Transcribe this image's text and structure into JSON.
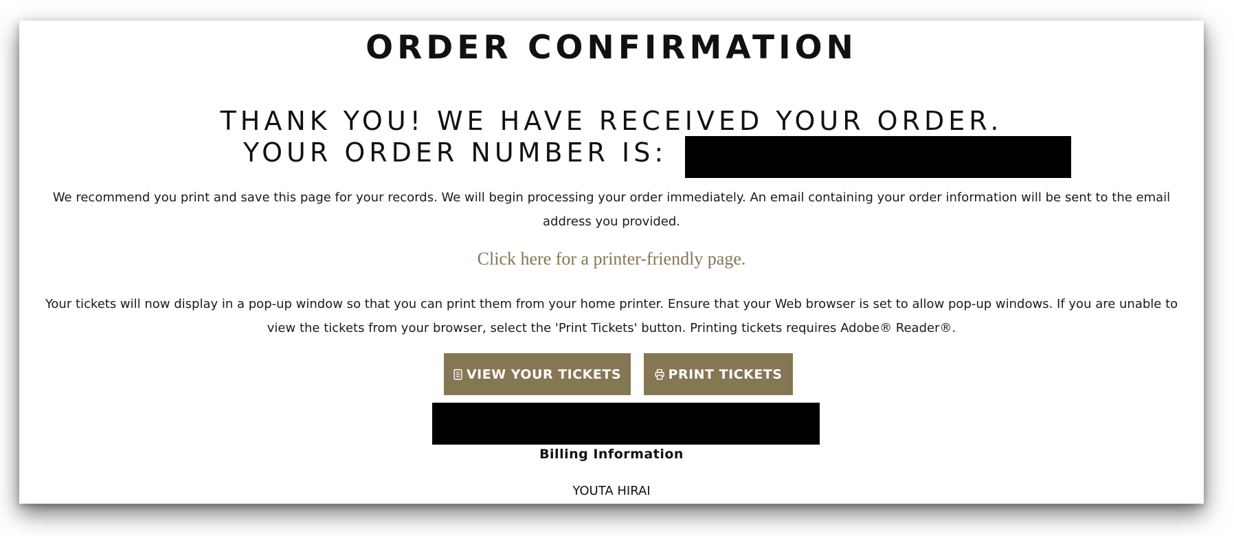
{
  "header": {
    "title": "ORDER CONFIRMATION"
  },
  "confirmation": {
    "thanks": "THANK YOU! WE HAVE RECEIVED YOUR ORDER.",
    "order_number_label": "YOUR ORDER NUMBER IS:",
    "order_number_value": ""
  },
  "notice": {
    "records_text": "We recommend you print and save this page for your records. We will begin processing your order immediately. An email containing your order information will be sent to the email address you provided.",
    "printer_link": "Click here for a printer-friendly page.",
    "tickets_text": "Your tickets will now display in a pop-up window so that you can print them from your home printer. Ensure that your Web browser is set to allow pop-up windows. If you are unable to view the tickets from your browser, select the 'Print Tickets' button. Printing tickets requires Adobe® Reader®."
  },
  "actions": {
    "view_tickets_label": "VIEW YOUR TICKETS",
    "view_tickets_icon": "document-icon",
    "print_tickets_label": "PRINT TICKETS",
    "print_tickets_icon": "printer-icon"
  },
  "billing": {
    "heading": "Billing Information",
    "name": "YOUTA HIRAI"
  },
  "colors": {
    "accent": "#857754",
    "text": "#111111",
    "redaction": "#000000",
    "background": "#ffffff"
  }
}
